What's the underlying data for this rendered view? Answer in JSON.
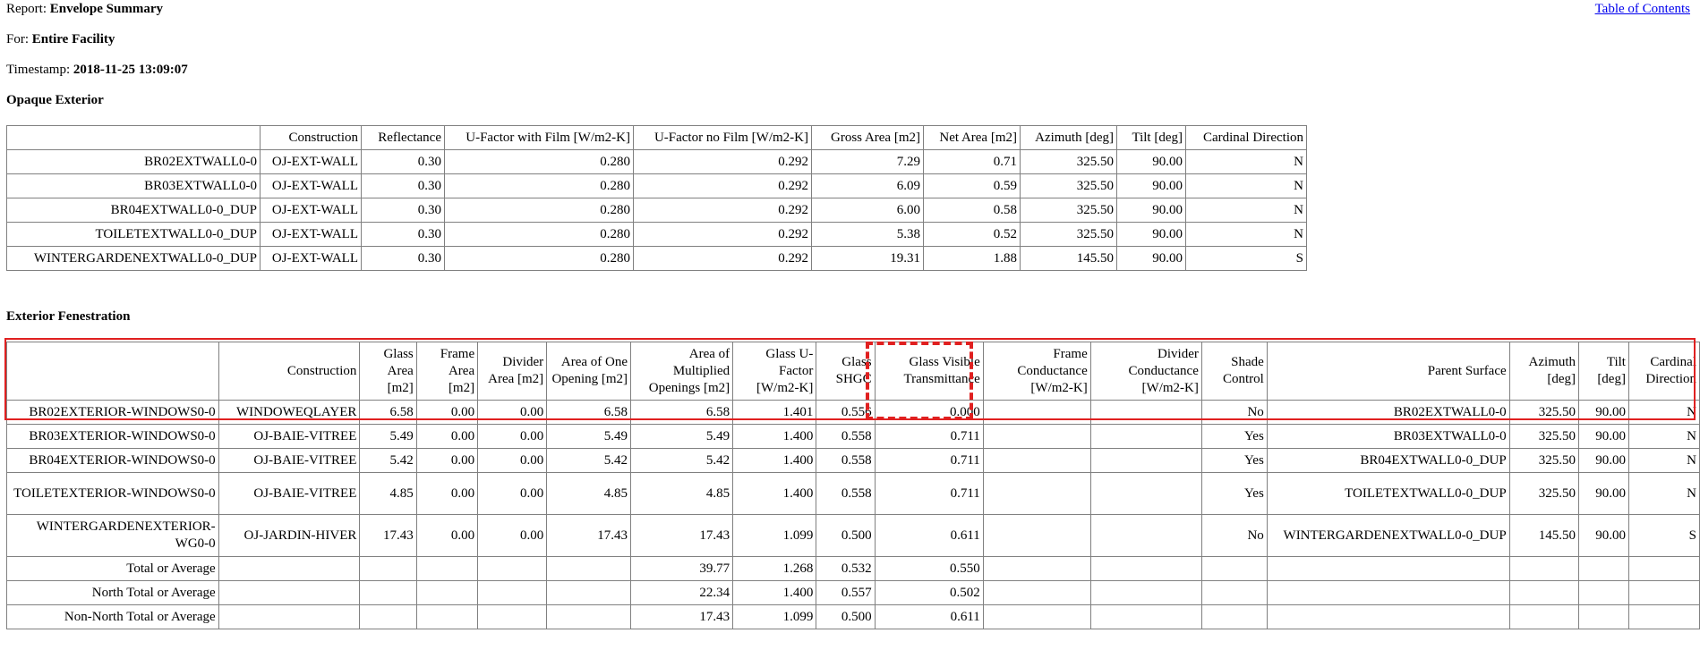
{
  "report": {
    "report_label": "Report:",
    "report_name": "Envelope Summary",
    "for_label": "For:",
    "for_value": "Entire Facility",
    "timestamp_label": "Timestamp:",
    "timestamp_value": "2018-11-25 13:09:07",
    "toc_link": "Table of Contents"
  },
  "opaque": {
    "title": "Opaque Exterior",
    "headers": [
      "",
      "Construction",
      "Reflectance",
      "U-Factor with Film [W/m2-K]",
      "U-Factor no Film [W/m2-K]",
      "Gross Area [m2]",
      "Net Area [m2]",
      "Azimuth [deg]",
      "Tilt [deg]",
      "Cardinal Direction"
    ],
    "rows": [
      [
        "BR02EXTWALL0-0",
        "OJ-EXT-WALL",
        "0.30",
        "0.280",
        "0.292",
        "7.29",
        "0.71",
        "325.50",
        "90.00",
        "N"
      ],
      [
        "BR03EXTWALL0-0",
        "OJ-EXT-WALL",
        "0.30",
        "0.280",
        "0.292",
        "6.09",
        "0.59",
        "325.50",
        "90.00",
        "N"
      ],
      [
        "BR04EXTWALL0-0_DUP",
        "OJ-EXT-WALL",
        "0.30",
        "0.280",
        "0.292",
        "6.00",
        "0.58",
        "325.50",
        "90.00",
        "N"
      ],
      [
        "TOILETEXTWALL0-0_DUP",
        "OJ-EXT-WALL",
        "0.30",
        "0.280",
        "0.292",
        "5.38",
        "0.52",
        "325.50",
        "90.00",
        "N"
      ],
      [
        "WINTERGARDENEXTWALL0-0_DUP",
        "OJ-EXT-WALL",
        "0.30",
        "0.280",
        "0.292",
        "19.31",
        "1.88",
        "145.50",
        "90.00",
        "S"
      ]
    ]
  },
  "fenestration": {
    "title": "Exterior Fenestration",
    "headers": [
      "",
      "Construction",
      "Glass Area [m2]",
      "Frame Area [m2]",
      "Divider Area [m2]",
      "Area of One Opening [m2]",
      "Area of Multiplied Openings [m2]",
      "Glass U-Factor [W/m2-K]",
      "Glass SHGC",
      "Glass Visible Transmittance",
      "Frame Conductance [W/m2-K]",
      "Divider Conductance [W/m2-K]",
      "Shade Control",
      "Parent Surface",
      "Azimuth [deg]",
      "Tilt [deg]",
      "Cardinal Direction"
    ],
    "rows": [
      [
        "BR02EXTERIOR-WINDOWS0-0",
        "WINDOWEQLAYER",
        "6.58",
        "0.00",
        "0.00",
        "6.58",
        "6.58",
        "1.401",
        "0.556",
        "0.000",
        "",
        "",
        "No",
        "BR02EXTWALL0-0",
        "325.50",
        "90.00",
        "N"
      ],
      [
        "BR03EXTERIOR-WINDOWS0-0",
        "OJ-BAIE-VITREE",
        "5.49",
        "0.00",
        "0.00",
        "5.49",
        "5.49",
        "1.400",
        "0.558",
        "0.711",
        "",
        "",
        "Yes",
        "BR03EXTWALL0-0",
        "325.50",
        "90.00",
        "N"
      ],
      [
        "BR04EXTERIOR-WINDOWS0-0",
        "OJ-BAIE-VITREE",
        "5.42",
        "0.00",
        "0.00",
        "5.42",
        "5.42",
        "1.400",
        "0.558",
        "0.711",
        "",
        "",
        "Yes",
        "BR04EXTWALL0-0_DUP",
        "325.50",
        "90.00",
        "N"
      ],
      [
        "TOILETEXTERIOR-WINDOWS0-0",
        "OJ-BAIE-VITREE",
        "4.85",
        "0.00",
        "0.00",
        "4.85",
        "4.85",
        "1.400",
        "0.558",
        "0.711",
        "",
        "",
        "Yes",
        "TOILETEXTWALL0-0_DUP",
        "325.50",
        "90.00",
        "N"
      ],
      [
        "WINTERGARDENEXTERIOR-WG0-0",
        "OJ-JARDIN-HIVER",
        "17.43",
        "0.00",
        "0.00",
        "17.43",
        "17.43",
        "1.099",
        "0.500",
        "0.611",
        "",
        "",
        "No",
        "WINTERGARDENEXTWALL0-0_DUP",
        "145.50",
        "90.00",
        "S"
      ],
      [
        "Total or Average",
        "",
        "",
        "",
        "",
        "",
        "39.77",
        "1.268",
        "0.532",
        "0.550",
        "",
        "",
        "",
        "",
        "",
        "",
        ""
      ],
      [
        "North Total or Average",
        "",
        "",
        "",
        "",
        "",
        "22.34",
        "1.400",
        "0.557",
        "0.502",
        "",
        "",
        "",
        "",
        "",
        "",
        ""
      ],
      [
        "Non-North Total or Average",
        "",
        "",
        "",
        "",
        "",
        "17.43",
        "1.099",
        "0.500",
        "0.611",
        "",
        "",
        "",
        "",
        "",
        "",
        ""
      ]
    ]
  },
  "highlight_color": "#e02020",
  "link_color": "#0000ee"
}
